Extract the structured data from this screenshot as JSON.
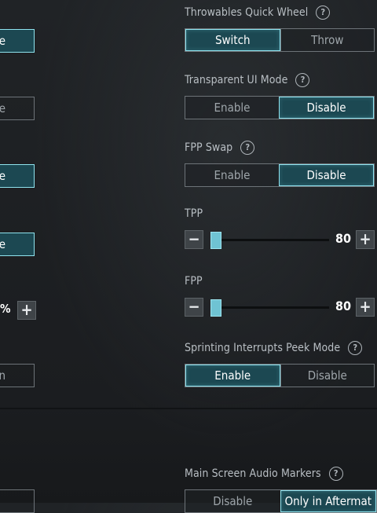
{
  "left_column": {
    "buttons": [
      "e",
      "e",
      "e",
      "e",
      "n"
    ],
    "percent_text": "%",
    "plus_symbol": "+"
  },
  "settings": {
    "throwables": {
      "label": "Throwables Quick Wheel",
      "help": "?",
      "options": [
        "Switch",
        "Throw"
      ],
      "selected": "Switch"
    },
    "transparent_ui": {
      "label": "Transparent UI Mode",
      "help": "?",
      "options": [
        "Enable",
        "Disable"
      ],
      "selected": "Disable"
    },
    "fpp_swap": {
      "label": "FPP Swap",
      "help": "?",
      "options": [
        "Enable",
        "Disable"
      ],
      "selected": "Disable"
    },
    "tpp": {
      "label": "TPP",
      "value": "80",
      "level_fraction": 0.03,
      "minus": "−",
      "plus": "+"
    },
    "fpp": {
      "label": "FPP",
      "value": "80",
      "level_fraction": 0.03,
      "minus": "−",
      "plus": "+"
    },
    "sprinting_peek": {
      "label": "Sprinting Interrupts Peek Mode",
      "help": "?",
      "options": [
        "Enable",
        "Disable"
      ],
      "selected": "Enable"
    },
    "audio_markers": {
      "label": "Main Screen Audio Markers",
      "help": "?",
      "options": [
        "Disable",
        "Only in Aftermat"
      ],
      "selected": "Only in Aftermat"
    }
  },
  "colors": {
    "accent_border": "#8fe3ee",
    "active_fill": "#1c4852",
    "slider_fill": "#5fb7c7"
  }
}
